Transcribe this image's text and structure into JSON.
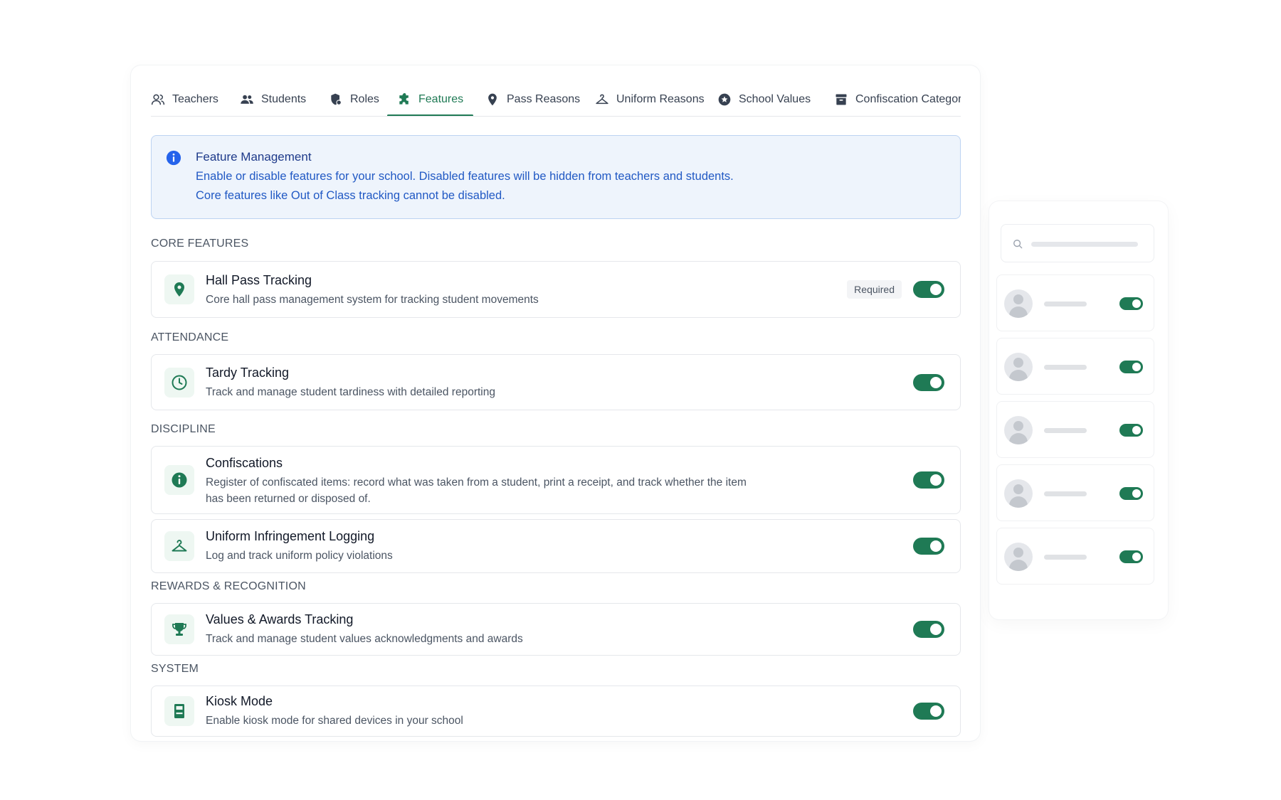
{
  "tabs": [
    {
      "label": "Teachers",
      "icon": "teachers-icon",
      "active": false
    },
    {
      "label": "Students",
      "icon": "students-icon",
      "active": false
    },
    {
      "label": "Roles",
      "icon": "roles-icon",
      "active": false
    },
    {
      "label": "Features",
      "icon": "puzzle-icon",
      "active": true
    },
    {
      "label": "Pass Reasons",
      "icon": "map-pin-icon",
      "active": false
    },
    {
      "label": "Uniform Reasons",
      "icon": "hanger-icon",
      "active": false
    },
    {
      "label": "School Values",
      "icon": "star-badge-icon",
      "active": false
    },
    {
      "label": "Confiscation Categorie",
      "icon": "archive-icon",
      "active": false
    }
  ],
  "info": {
    "title": "Feature Management",
    "line1": "Enable or disable features for your school. Disabled features will be hidden from teachers and students.",
    "line2": "Core features like Out of Class tracking cannot be disabled."
  },
  "sections": {
    "core": "CORE FEATURES",
    "attendance": "ATTENDANCE",
    "discipline": "DISCIPLINE",
    "rewards": "REWARDS & RECOGNITION",
    "system": "SYSTEM"
  },
  "features": {
    "hall_pass": {
      "name": "Hall Pass Tracking",
      "desc": "Core hall pass management system for tracking student movements",
      "badge": "Required",
      "enabled": true,
      "icon": "map-pin-icon"
    },
    "tardy": {
      "name": "Tardy Tracking",
      "desc": "Track and manage student tardiness with detailed reporting",
      "enabled": true,
      "icon": "clock-icon"
    },
    "confiscations": {
      "name": "Confiscations",
      "desc": "Register of confiscated items: record what was taken from a student, print a receipt, and track whether the item has been returned or disposed of.",
      "enabled": true,
      "icon": "info-icon"
    },
    "uniform": {
      "name": "Uniform Infringement Logging",
      "desc": "Log and track uniform policy violations",
      "enabled": true,
      "icon": "hanger-icon"
    },
    "values": {
      "name": "Values & Awards Tracking",
      "desc": "Track and manage student values acknowledgments and awards",
      "enabled": true,
      "icon": "trophy-icon"
    },
    "kiosk": {
      "name": "Kiosk Mode",
      "desc": "Enable kiosk mode for shared devices in your school",
      "enabled": true,
      "icon": "kiosk-icon"
    }
  },
  "colors": {
    "accent": "#1f7a55",
    "info_bg": "#eef4fc",
    "info_text": "#2159c4"
  }
}
